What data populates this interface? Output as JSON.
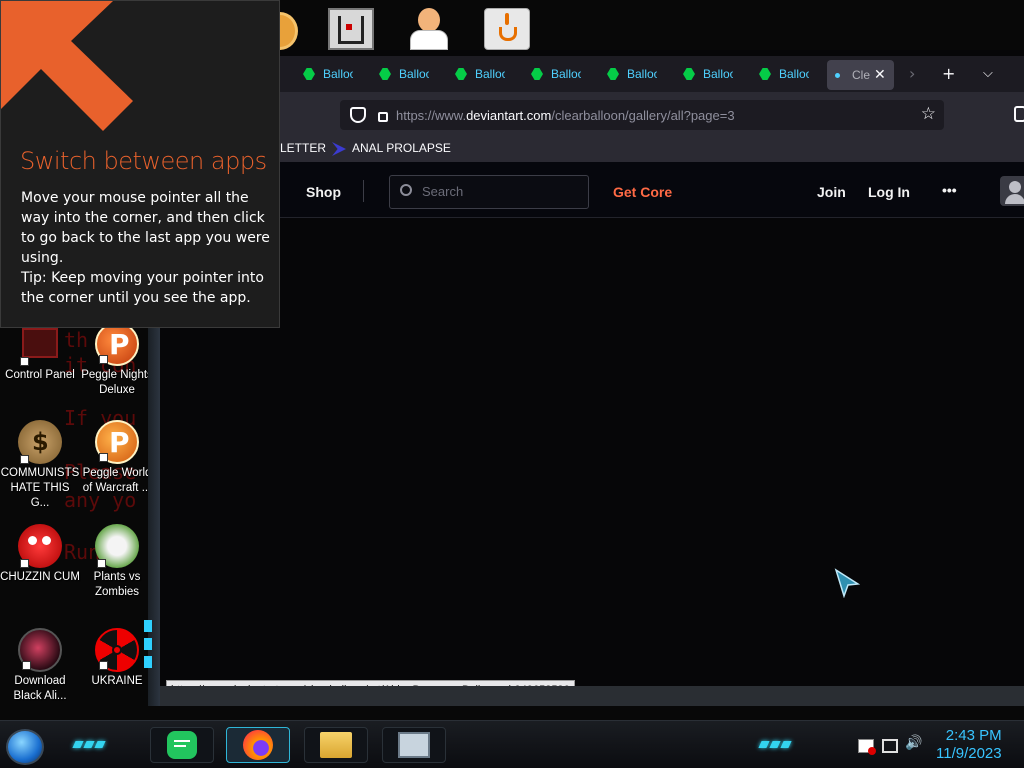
{
  "charm_tip": {
    "title": "Switch between apps",
    "body": "Move your mouse pointer all the way into the corner, and then click to go back to the last app you were using.",
    "tip": "Tip: Keep moving your pointer into the corner until you see the app."
  },
  "desktop": {
    "icons": [
      {
        "label": "Control Panel",
        "icon": "control-panel-icon"
      },
      {
        "label": "Peggle Nights Deluxe",
        "icon": "peggle-icon"
      },
      {
        "label": "COMMUNISTS HATE THIS G...",
        "icon": "money-bag-icon"
      },
      {
        "label": "Peggle World of Warcraft ...",
        "icon": "peggle-icon"
      },
      {
        "label": "CHUZZIN CUM",
        "icon": "chuzzle-icon"
      },
      {
        "label": "Plants vs Zombies",
        "icon": "plants-vs-zombies-icon"
      },
      {
        "label": "Download Black Ali...",
        "icon": "black-orb-icon"
      },
      {
        "label": "UKRAINE",
        "icon": "radiation-icon"
      }
    ],
    "top_icons": [
      "orange-app-icon",
      "maze-game-icon",
      "doctor-icon",
      "java-icon"
    ],
    "background_text": [
      "th   y",
      "it  con",
      "If you",
      "Please",
      "any yo",
      "Run on"
    ]
  },
  "browser": {
    "tabs": [
      {
        "label": "Balloo"
      },
      {
        "label": "Balloo"
      },
      {
        "label": "Balloo"
      },
      {
        "label": "Balloo"
      },
      {
        "label": "Balloo"
      },
      {
        "label": "Balloo"
      },
      {
        "label": "Balloo"
      },
      {
        "label": "Clear"
      }
    ],
    "url": {
      "prefix": "https://www.",
      "domain": "deviantart.com",
      "path": "/clearballoon/gallery/all?page=3"
    },
    "bookmarks": [
      {
        "label": "LETTER"
      },
      {
        "label": "ANAL PROLAPSE"
      }
    ],
    "site_nav": {
      "shop": "Shop",
      "search_placeholder": "Search",
      "get_core": "Get Core",
      "join": "Join",
      "login": "Log In",
      "more": "•••"
    },
    "status_url": "https://www.deviantart.com/clearballoon/art/Abby-Becomes-Ballooned-949658536"
  },
  "taskbar": {
    "time": "2:43 PM",
    "date": "11/9/2023",
    "pinned": [
      "messages-icon",
      "firefox-icon",
      "file-explorer-icon",
      "task-manager-icon"
    ]
  },
  "colors": {
    "accent_orange": "#e8612c",
    "tab_cyan": "#4fd1ff",
    "deviantart_green": "#05cc47",
    "get_core_orange": "#ff6a45",
    "clock_blue": "#38c4ff"
  }
}
